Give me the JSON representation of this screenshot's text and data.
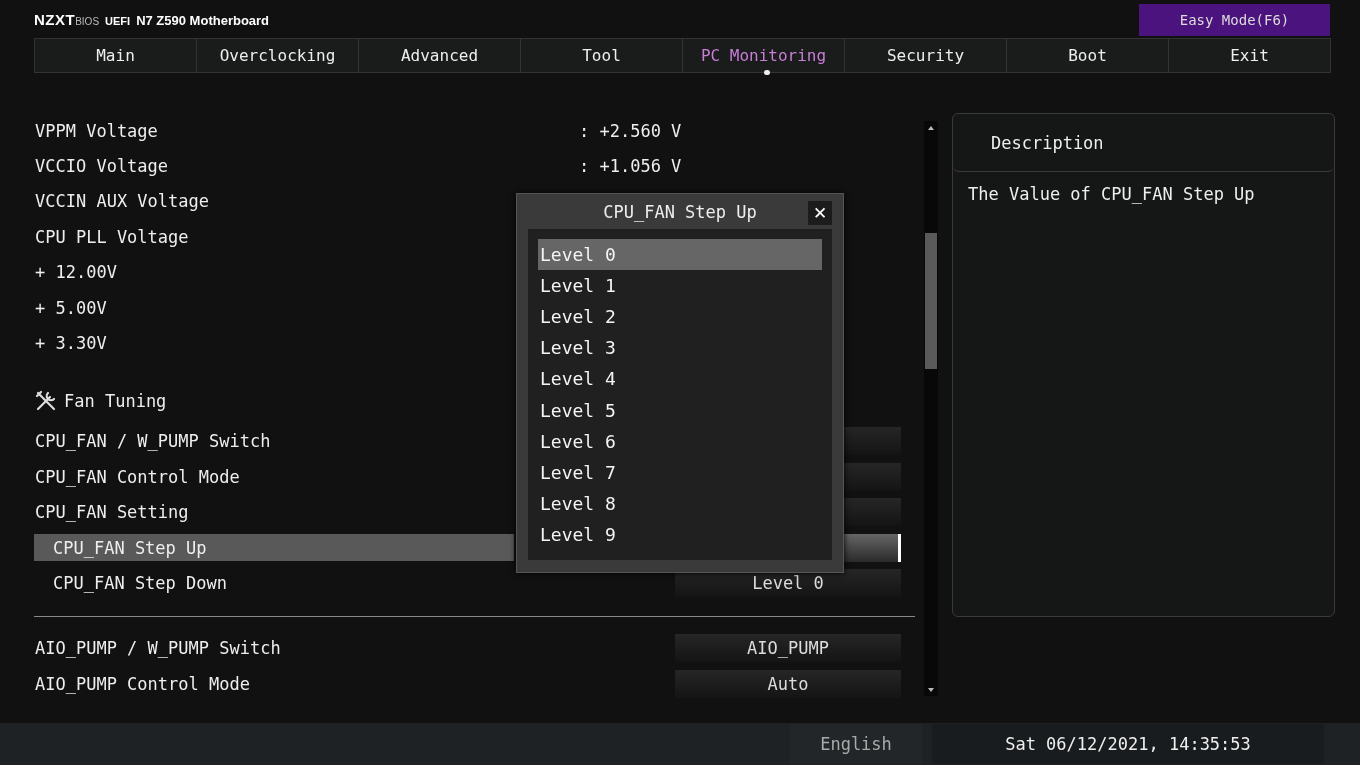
{
  "header": {
    "brand": "NZXT",
    "brand_sub": "BIOS",
    "firmware": "UEFI",
    "model": "N7 Z590 Motherboard",
    "mode_button": "Easy Mode(F6)"
  },
  "tabs": [
    {
      "label": "Main",
      "selected": false
    },
    {
      "label": "Overclocking",
      "selected": false
    },
    {
      "label": "Advanced",
      "selected": false
    },
    {
      "label": "Tool",
      "selected": false
    },
    {
      "label": "PC Monitoring",
      "selected": true
    },
    {
      "label": "Security",
      "selected": false
    },
    {
      "label": "Boot",
      "selected": false
    },
    {
      "label": "Exit",
      "selected": false
    }
  ],
  "rows": [
    {
      "kind": "reading",
      "label": "VPPM Voltage",
      "value": ": +2.560 V"
    },
    {
      "kind": "reading",
      "label": "VCCIO Voltage",
      "value": ": +1.056 V"
    },
    {
      "kind": "reading",
      "label": "VCCIN AUX Voltage"
    },
    {
      "kind": "reading",
      "label": "CPU PLL Voltage"
    },
    {
      "kind": "reading",
      "label": "+ 12.00V"
    },
    {
      "kind": "reading",
      "label": "+ 5.00V"
    },
    {
      "kind": "reading",
      "label": "+ 3.30V"
    },
    {
      "kind": "header",
      "label": "Fan Tuning"
    },
    {
      "kind": "option",
      "label": "CPU_FAN / W_PUMP Switch",
      "selected": false
    },
    {
      "kind": "option",
      "label": "CPU_FAN Control Mode",
      "selected": false
    },
    {
      "kind": "option",
      "label": "CPU_FAN Setting",
      "selected": false
    },
    {
      "kind": "suboption",
      "label": "CPU_FAN Step Up",
      "selected": true
    },
    {
      "kind": "suboption",
      "label": "CPU_FAN Step Down",
      "value": "Level 0",
      "selected": false
    },
    {
      "kind": "divider"
    },
    {
      "kind": "option",
      "label": "AIO_PUMP / W_PUMP Switch",
      "value": "AIO_PUMP",
      "selected": false
    },
    {
      "kind": "option",
      "label": "AIO_PUMP Control Mode",
      "value": "Auto",
      "selected": false
    }
  ],
  "description": {
    "title": "Description",
    "text": "The Value of CPU_FAN Step Up"
  },
  "dialog": {
    "title": "CPU_FAN Step Up",
    "close": "✕",
    "options": [
      {
        "label": "Level 0",
        "selected": true
      },
      {
        "label": "Level 1",
        "selected": false
      },
      {
        "label": "Level 2",
        "selected": false
      },
      {
        "label": "Level 3",
        "selected": false
      },
      {
        "label": "Level 4",
        "selected": false
      },
      {
        "label": "Level 5",
        "selected": false
      },
      {
        "label": "Level 6",
        "selected": false
      },
      {
        "label": "Level 7",
        "selected": false
      },
      {
        "label": "Level 8",
        "selected": false
      },
      {
        "label": "Level 9",
        "selected": false
      }
    ]
  },
  "status_bar": {
    "language": "English",
    "datetime": "Sat 06/12/2021, 14:35:53"
  }
}
